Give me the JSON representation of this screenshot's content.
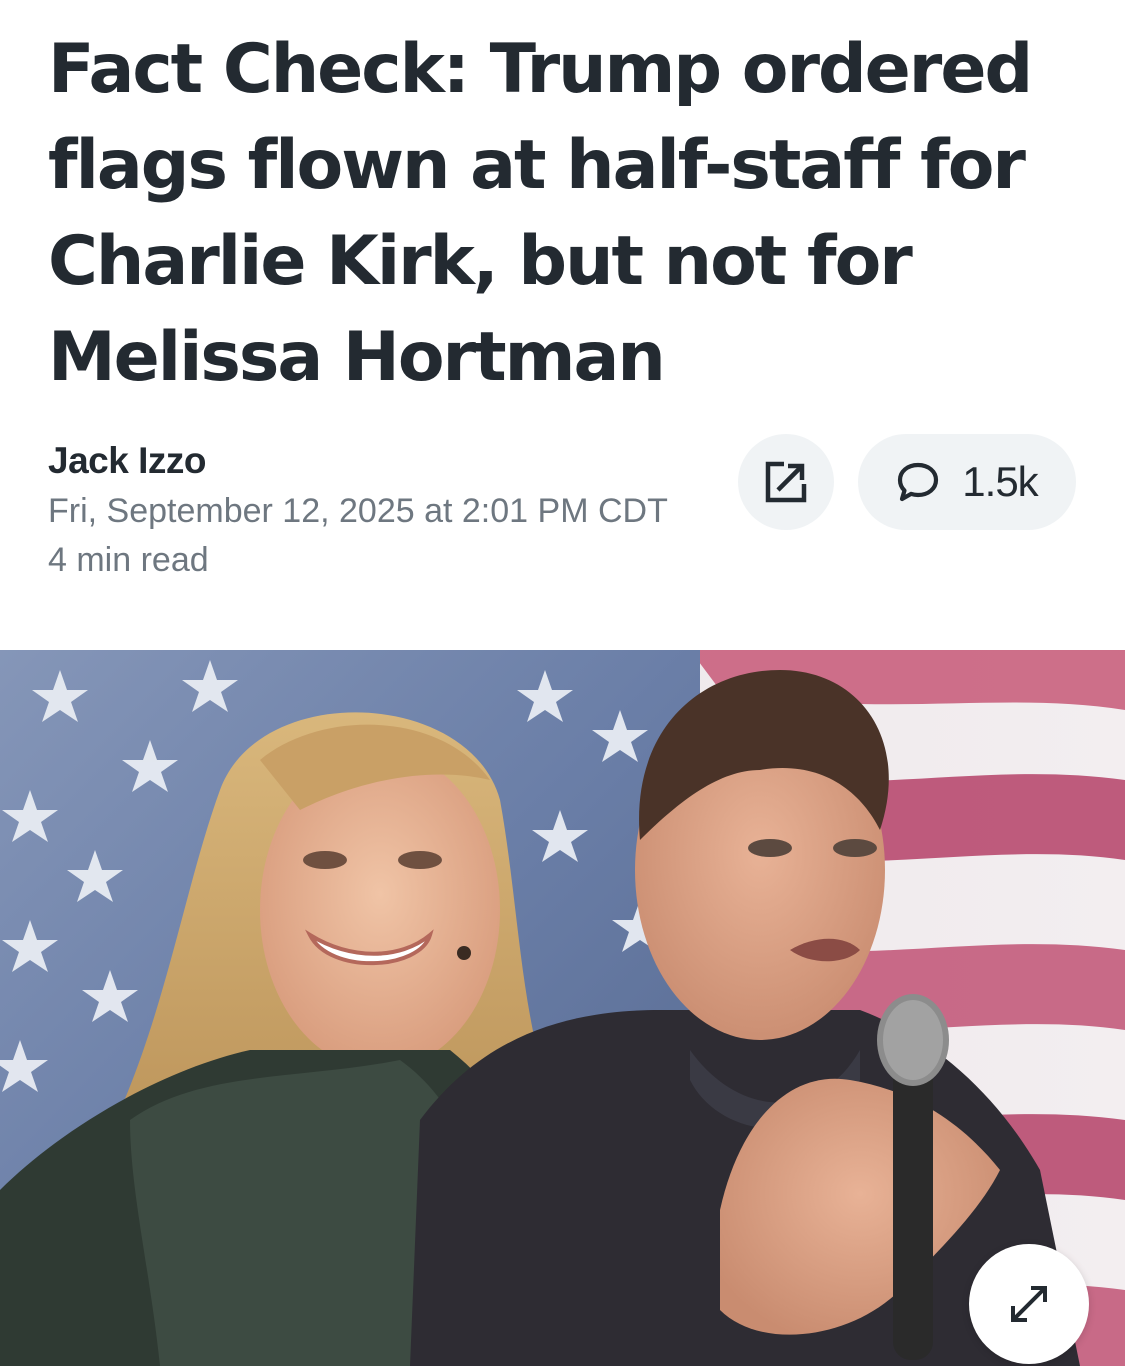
{
  "article": {
    "headline": "Fact Check: Trump ordered flags flown at half-staff for Charlie Kirk, but not for Melissa Hortman",
    "author": "Jack Izzo",
    "published": "Fri, September 12, 2025 at 2:01 PM CDT",
    "read_time": "4 min read"
  },
  "actions": {
    "share_icon": "share-external-icon",
    "comment_icon": "speech-bubble-icon",
    "comment_count": "1.5k",
    "expand_icon": "expand-arrows-icon"
  },
  "hero_image": {
    "subject": "woman-and-man-portrait-in-front-of-american-flag"
  },
  "colors": {
    "text_primary": "#232a31",
    "text_secondary": "#6e7780",
    "button_bg": "#f0f3f5"
  }
}
